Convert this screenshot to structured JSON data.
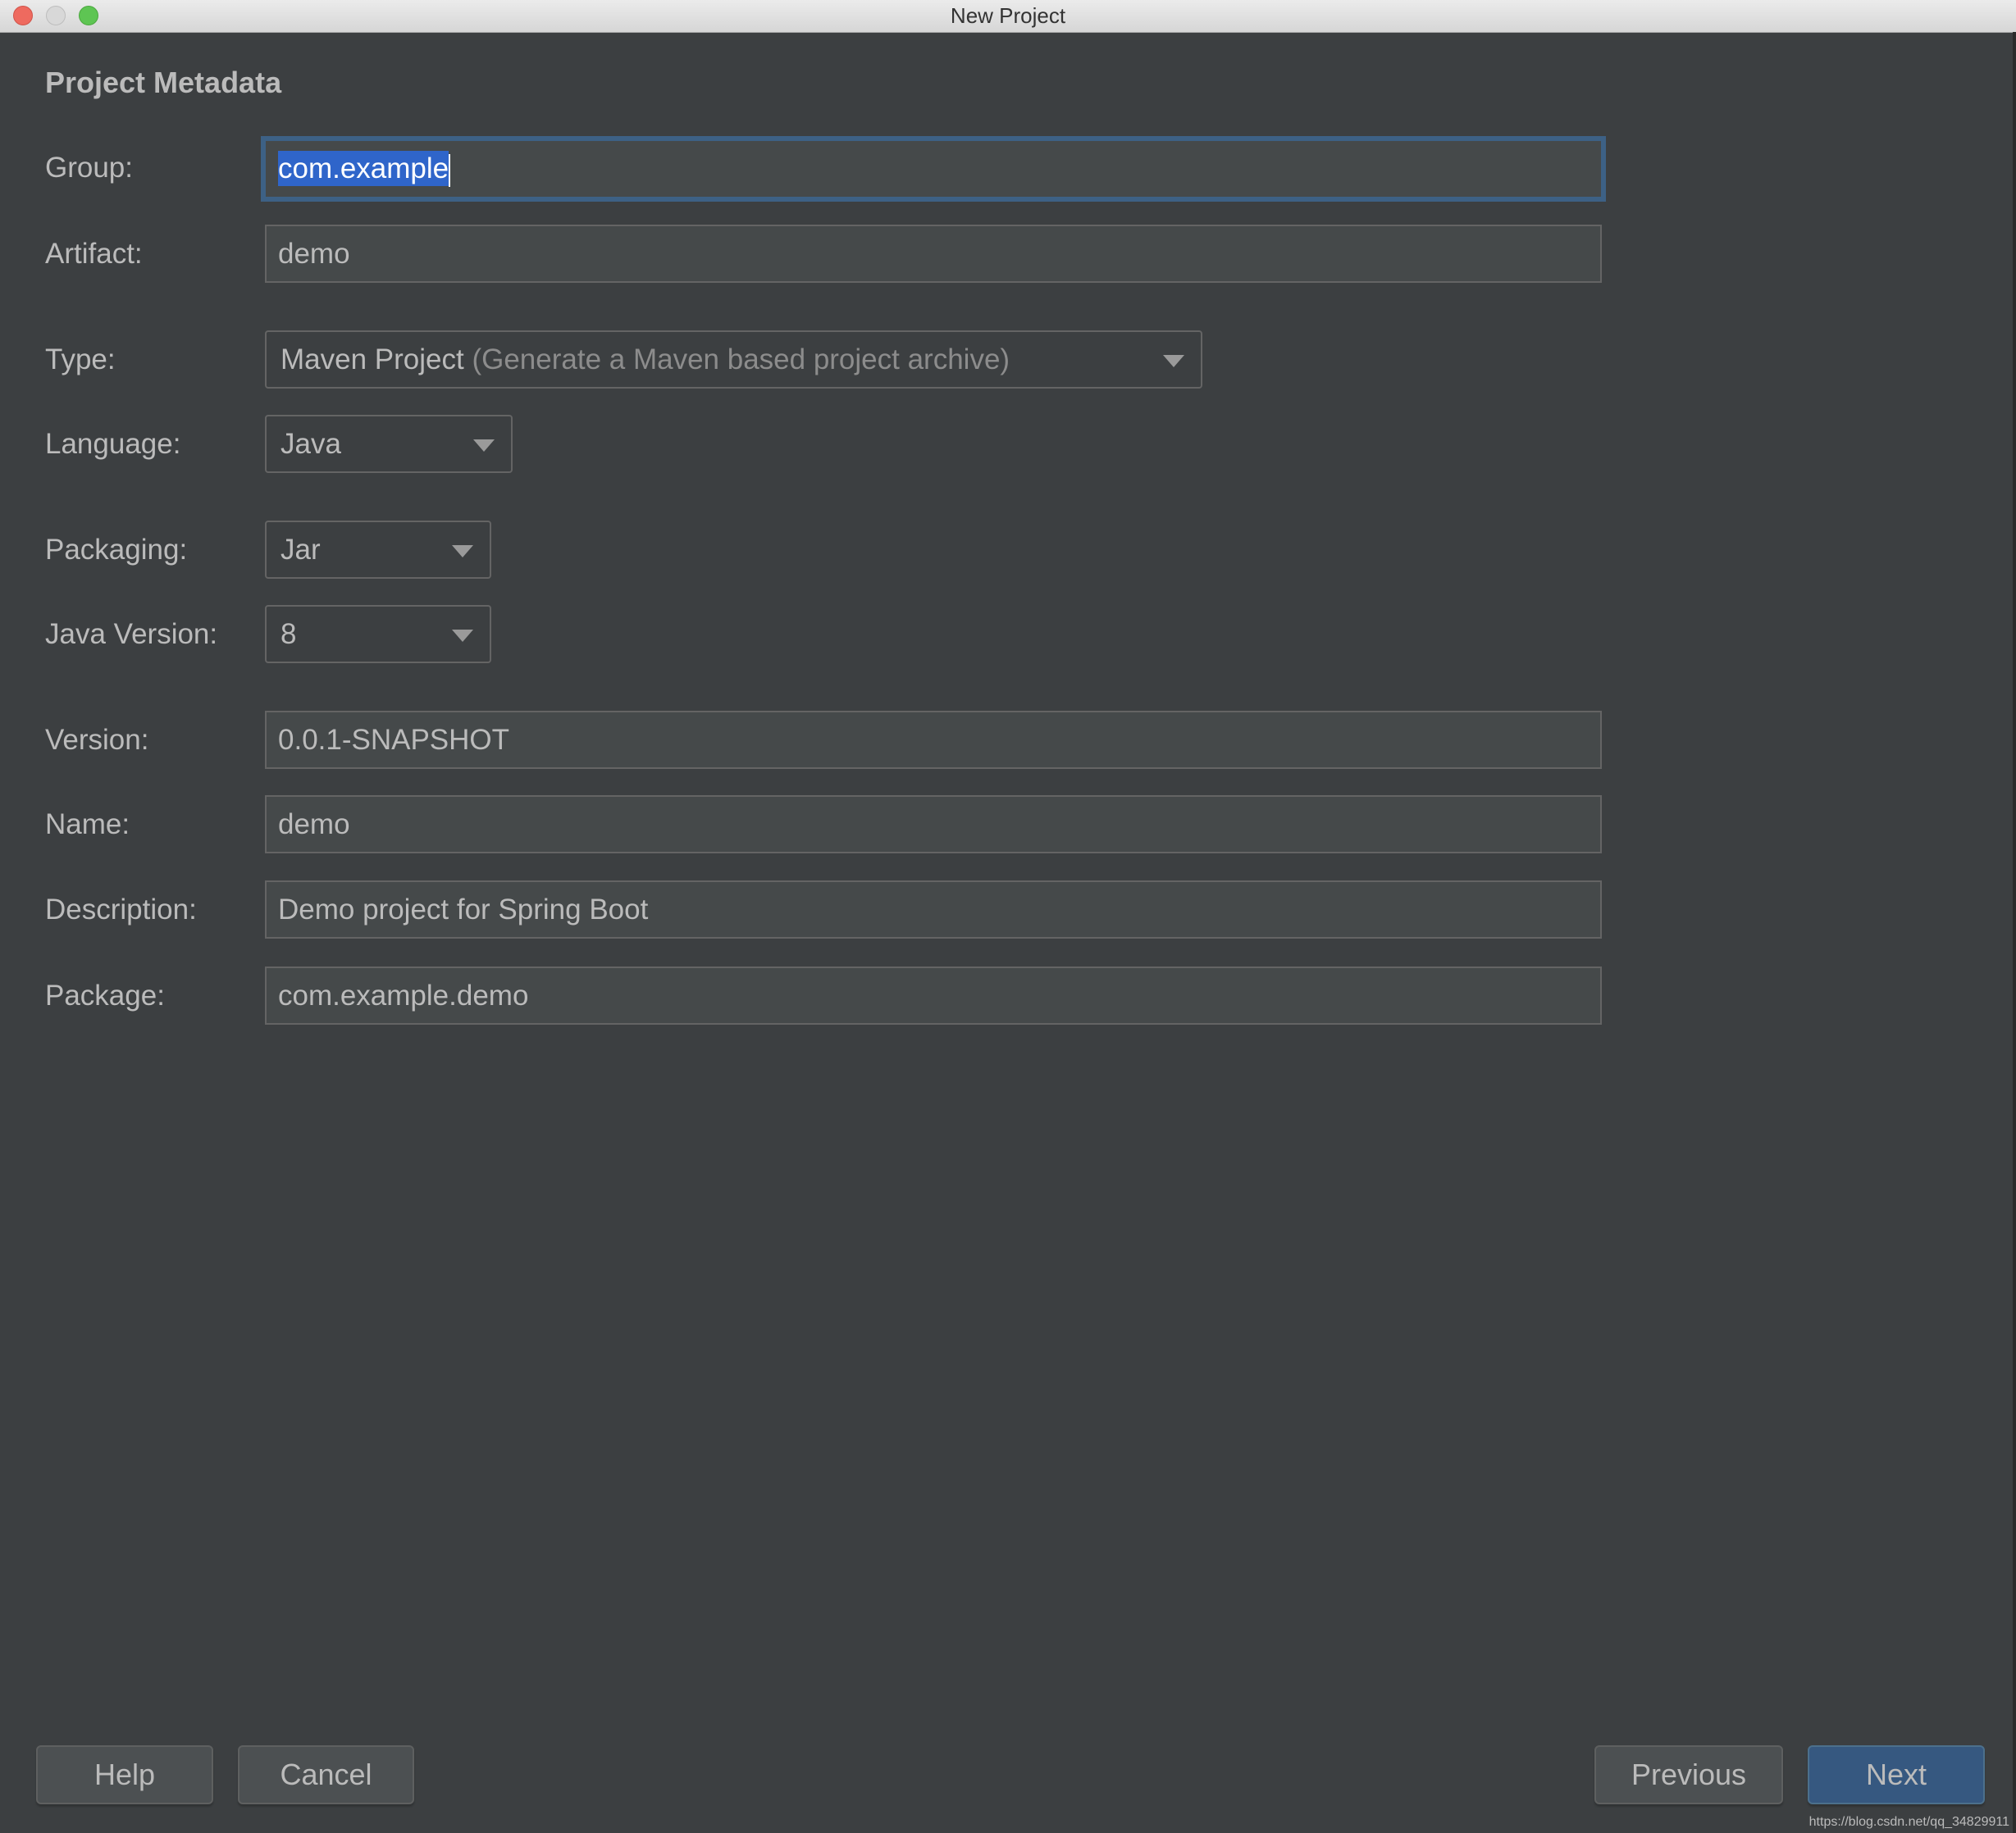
{
  "window": {
    "title": "New Project",
    "traffic_lights": [
      "close",
      "minimize",
      "maximize"
    ]
  },
  "section_title": "Project Metadata",
  "fields": {
    "group": {
      "label": "Group:",
      "value": "com.example",
      "selected": true,
      "focused": true
    },
    "artifact": {
      "label": "Artifact:",
      "value": "demo"
    },
    "type": {
      "label": "Type:",
      "value": "Maven Project",
      "hint": "(Generate a Maven based project archive)"
    },
    "language": {
      "label": "Language:",
      "value": "Java"
    },
    "packaging": {
      "label": "Packaging:",
      "value": "Jar"
    },
    "java_version": {
      "label": "Java Version:",
      "value": "8"
    },
    "version": {
      "label": "Version:",
      "value": "0.0.1-SNAPSHOT"
    },
    "name": {
      "label": "Name:",
      "value": "demo"
    },
    "description": {
      "label": "Description:",
      "value": "Demo project for Spring Boot"
    },
    "package": {
      "label": "Package:",
      "value": "com.example.demo"
    }
  },
  "buttons": {
    "help": "Help",
    "cancel": "Cancel",
    "previous": "Previous",
    "next": "Next"
  },
  "watermark": "https://blog.csdn.net/qq_34829911",
  "colors": {
    "background": "#3c3f41",
    "field_background": "#45494a",
    "focus_border": "#3d6185",
    "selection": "#2f65ca",
    "primary_button": "#365880"
  }
}
